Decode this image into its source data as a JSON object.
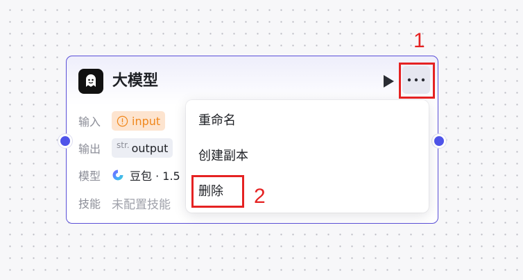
{
  "node": {
    "title": "大模型",
    "inputs_label": "输入",
    "input_param": "input",
    "outputs_label": "输出",
    "output_type": "str.",
    "output_param": "output",
    "model_label": "模型",
    "model_value": "豆包 · 1.5",
    "skills_label": "技能",
    "skills_value": "未配置技能"
  },
  "menu": {
    "items": [
      "重命名",
      "创建副本",
      "删除"
    ]
  },
  "annotations": [
    "1",
    "2"
  ],
  "colors": {
    "accent": "#4f54e9",
    "node_border": "#5a4fd8",
    "warning": "#f0871c",
    "annotation": "#e52222"
  },
  "icons": {
    "node": "llm-robot-icon",
    "run": "play-icon",
    "more": "more-horizontal-icon",
    "warning": "warning-circle-icon",
    "model": "doubao-model-icon"
  }
}
